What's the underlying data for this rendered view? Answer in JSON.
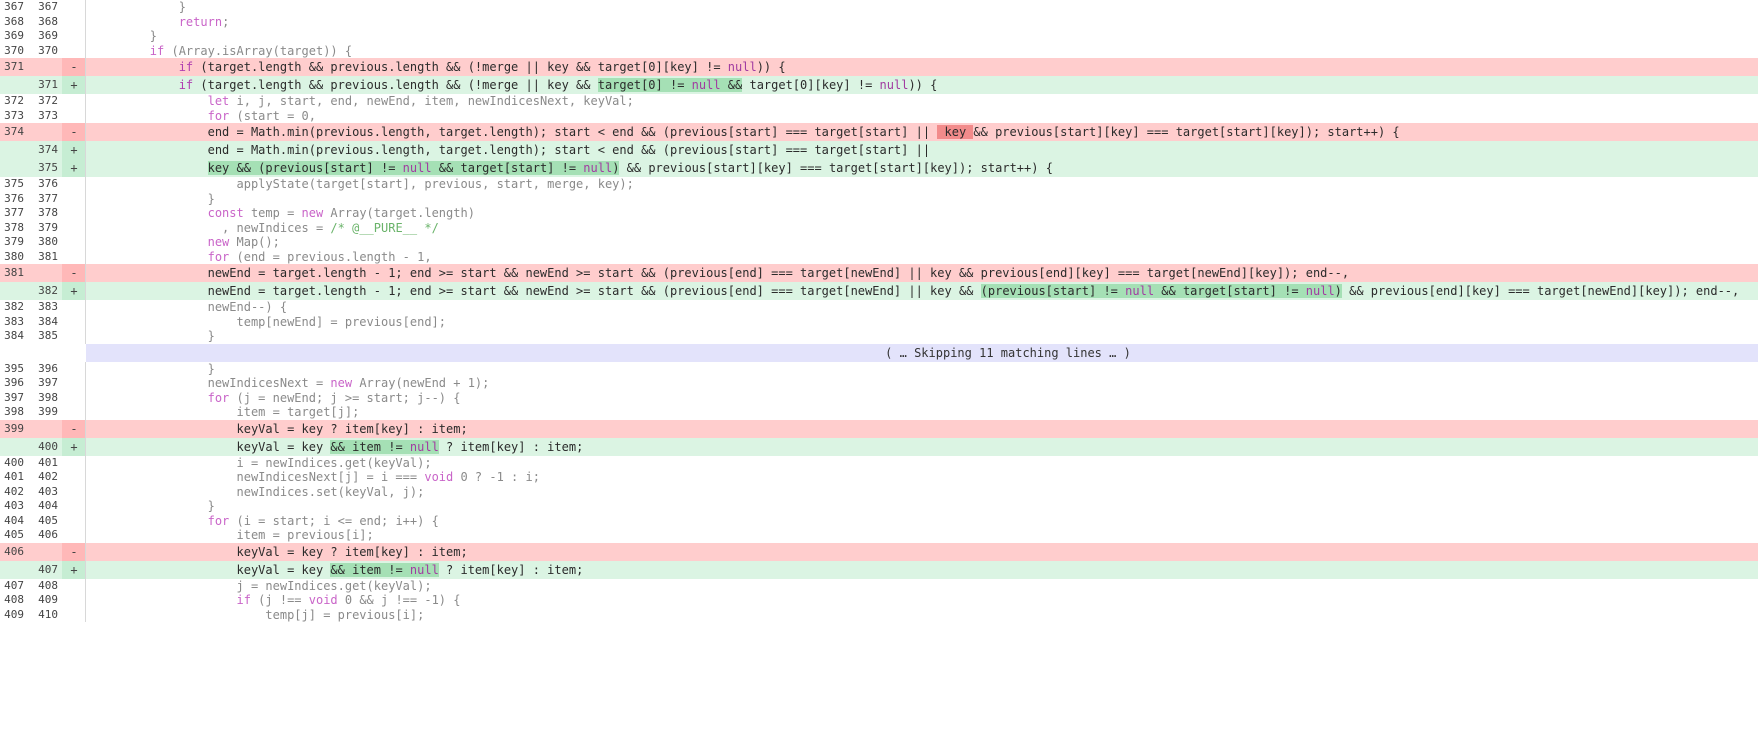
{
  "skip_label": "( … Skipping 11 matching lines … )",
  "lines": [
    {
      "kind": "ctx",
      "old": "367",
      "new": "367",
      "sign": "",
      "code": "            }"
    },
    {
      "kind": "ctx",
      "old": "368",
      "new": "368",
      "sign": "",
      "code": "            return;"
    },
    {
      "kind": "ctx",
      "old": "369",
      "new": "369",
      "sign": "",
      "code": "        }"
    },
    {
      "kind": "ctx",
      "old": "370",
      "new": "370",
      "sign": "",
      "code": "        if (Array.isArray(target)) {"
    },
    {
      "kind": "del",
      "old": "371",
      "new": "",
      "sign": "-",
      "code": "            if (target.length && previous.length && (!merge || key && target[0][key] != null)) {"
    },
    {
      "kind": "add",
      "old": "",
      "new": "371",
      "sign": "+",
      "code": "            if (target.length && previous.length && (!merge || key && target[0] != null && target[0][key] != null)) {"
    },
    {
      "kind": "ctx",
      "old": "372",
      "new": "372",
      "sign": "",
      "code": "                let i, j, start, end, newEnd, item, newIndicesNext, keyVal;"
    },
    {
      "kind": "ctx",
      "old": "373",
      "new": "373",
      "sign": "",
      "code": "                for (start = 0,"
    },
    {
      "kind": "del",
      "old": "374",
      "new": "",
      "sign": "-",
      "code": "                end = Math.min(previous.length, target.length); start < end && (previous[start] === target[start] || key && previous[start][key] === target[start][key]); start++) {"
    },
    {
      "kind": "add",
      "old": "",
      "new": "374",
      "sign": "+",
      "code": "                end = Math.min(previous.length, target.length); start < end && (previous[start] === target[start] ||"
    },
    {
      "kind": "add",
      "old": "",
      "new": "375",
      "sign": "+",
      "code": "                key && (previous[start] != null && target[start] != null) && previous[start][key] === target[start][key]); start++) {"
    },
    {
      "kind": "ctx",
      "old": "375",
      "new": "376",
      "sign": "",
      "code": "                    applyState(target[start], previous, start, merge, key);"
    },
    {
      "kind": "ctx",
      "old": "376",
      "new": "377",
      "sign": "",
      "code": "                }"
    },
    {
      "kind": "ctx",
      "old": "377",
      "new": "378",
      "sign": "",
      "code": "                const temp = new Array(target.length)"
    },
    {
      "kind": "ctx",
      "old": "378",
      "new": "379",
      "sign": "",
      "code": "                  , newIndices = /* @__PURE__ */"
    },
    {
      "kind": "ctx",
      "old": "379",
      "new": "380",
      "sign": "",
      "code": "                new Map();"
    },
    {
      "kind": "ctx",
      "old": "380",
      "new": "381",
      "sign": "",
      "code": "                for (end = previous.length - 1,"
    },
    {
      "kind": "del",
      "old": "381",
      "new": "",
      "sign": "-",
      "code": "                newEnd = target.length - 1; end >= start && newEnd >= start && (previous[end] === target[newEnd] || key && previous[end][key] === target[newEnd][key]); end--,"
    },
    {
      "kind": "add",
      "old": "",
      "new": "382",
      "sign": "+",
      "code": "                newEnd = target.length - 1; end >= start && newEnd >= start && (previous[end] === target[newEnd] || key && (previous[start] != null && target[start] != null) && previous[end][key] === target[newEnd][key]); end--,"
    },
    {
      "kind": "ctx",
      "old": "382",
      "new": "383",
      "sign": "",
      "code": "                newEnd--) {"
    },
    {
      "kind": "ctx",
      "old": "383",
      "new": "384",
      "sign": "",
      "code": "                    temp[newEnd] = previous[end];"
    },
    {
      "kind": "ctx",
      "old": "384",
      "new": "385",
      "sign": "",
      "code": "                }"
    },
    {
      "kind": "skip"
    },
    {
      "kind": "ctx",
      "old": "395",
      "new": "396",
      "sign": "",
      "code": "                }"
    },
    {
      "kind": "ctx",
      "old": "396",
      "new": "397",
      "sign": "",
      "code": "                newIndicesNext = new Array(newEnd + 1);"
    },
    {
      "kind": "ctx",
      "old": "397",
      "new": "398",
      "sign": "",
      "code": "                for (j = newEnd; j >= start; j--) {"
    },
    {
      "kind": "ctx",
      "old": "398",
      "new": "399",
      "sign": "",
      "code": "                    item = target[j];"
    },
    {
      "kind": "del",
      "old": "399",
      "new": "",
      "sign": "-",
      "code": "                    keyVal = key ? item[key] : item;"
    },
    {
      "kind": "add",
      "old": "",
      "new": "400",
      "sign": "+",
      "code": "                    keyVal = key && item != null ? item[key] : item;"
    },
    {
      "kind": "ctx",
      "old": "400",
      "new": "401",
      "sign": "",
      "code": "                    i = newIndices.get(keyVal);"
    },
    {
      "kind": "ctx",
      "old": "401",
      "new": "402",
      "sign": "",
      "code": "                    newIndicesNext[j] = i === void 0 ? -1 : i;"
    },
    {
      "kind": "ctx",
      "old": "402",
      "new": "403",
      "sign": "",
      "code": "                    newIndices.set(keyVal, j);"
    },
    {
      "kind": "ctx",
      "old": "403",
      "new": "404",
      "sign": "",
      "code": "                }"
    },
    {
      "kind": "ctx",
      "old": "404",
      "new": "405",
      "sign": "",
      "code": "                for (i = start; i <= end; i++) {"
    },
    {
      "kind": "ctx",
      "old": "405",
      "new": "406",
      "sign": "",
      "code": "                    item = previous[i];"
    },
    {
      "kind": "del",
      "old": "406",
      "new": "",
      "sign": "-",
      "code": "                    keyVal = key ? item[key] : item;"
    },
    {
      "kind": "add",
      "old": "",
      "new": "407",
      "sign": "+",
      "code": "                    keyVal = key && item != null ? item[key] : item;"
    },
    {
      "kind": "ctx",
      "old": "407",
      "new": "408",
      "sign": "",
      "code": "                    j = newIndices.get(keyVal);"
    },
    {
      "kind": "ctx",
      "old": "408",
      "new": "409",
      "sign": "",
      "code": "                    if (j !== void 0 && j !== -1) {"
    },
    {
      "kind": "ctx",
      "old": "409",
      "new": "410",
      "sign": "",
      "code": "                        temp[j] = previous[i];"
    }
  ]
}
